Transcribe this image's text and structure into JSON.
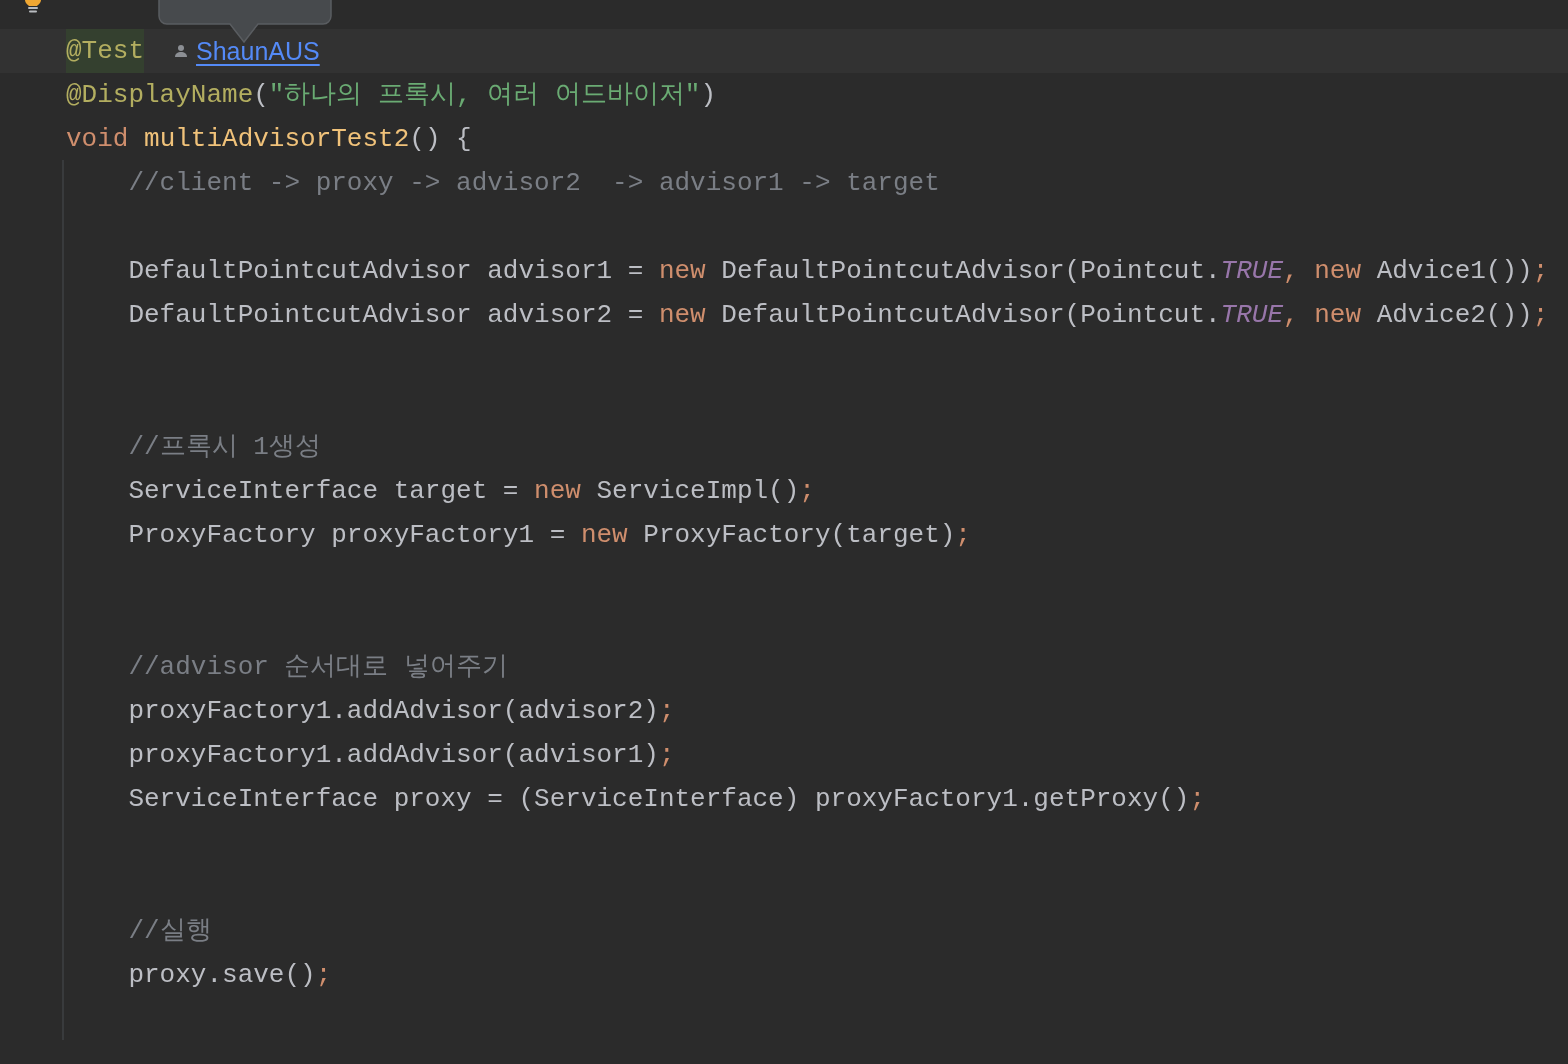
{
  "editor": {
    "lines": [
      {
        "kind": "current_code",
        "tokens": [
          {
            "kind": "annotation_match",
            "text": "@Test"
          }
        ],
        "author": "ShaunAUS"
      },
      {
        "kind": "code",
        "tokens": [
          {
            "kind": "annotation",
            "text": "@DisplayName"
          },
          {
            "kind": "plain",
            "text": "("
          },
          {
            "kind": "string",
            "text": "\"하나의 프록시, 여러 어드바이저\""
          },
          {
            "kind": "plain",
            "text": ")"
          }
        ]
      },
      {
        "kind": "code",
        "tokens": [
          {
            "kind": "keyword",
            "text": "void"
          },
          {
            "kind": "method",
            "text": " multiAdvisorTest2"
          },
          {
            "kind": "plain",
            "text": "() {"
          }
        ]
      },
      {
        "kind": "code",
        "tokens": [
          {
            "kind": "comment",
            "text": "    //client -> proxy -> advisor2  -> advisor1 -> target"
          }
        ]
      },
      {
        "kind": "blank"
      },
      {
        "kind": "code",
        "tokens": [
          {
            "kind": "plain",
            "text": "    DefaultPointcutAdvisor advisor1 = "
          },
          {
            "kind": "keyword",
            "text": "new"
          },
          {
            "kind": "plain",
            "text": " DefaultPointcutAdvisor(Pointcut."
          },
          {
            "kind": "constant",
            "text": "TRUE"
          },
          {
            "kind": "keyword",
            "text": ", new"
          },
          {
            "kind": "plain",
            "text": " Advice1())"
          },
          {
            "kind": "keyword",
            "text": ";"
          }
        ]
      },
      {
        "kind": "code",
        "tokens": [
          {
            "kind": "plain",
            "text": "    DefaultPointcutAdvisor advisor2 = "
          },
          {
            "kind": "keyword",
            "text": "new"
          },
          {
            "kind": "plain",
            "text": " DefaultPointcutAdvisor(Pointcut."
          },
          {
            "kind": "constant",
            "text": "TRUE"
          },
          {
            "kind": "keyword",
            "text": ", new"
          },
          {
            "kind": "plain",
            "text": " Advice2())"
          },
          {
            "kind": "keyword",
            "text": ";"
          }
        ]
      },
      {
        "kind": "blank"
      },
      {
        "kind": "blank"
      },
      {
        "kind": "code",
        "tokens": [
          {
            "kind": "comment",
            "text": "    //프록시 1생성"
          }
        ]
      },
      {
        "kind": "code",
        "tokens": [
          {
            "kind": "plain",
            "text": "    ServiceInterface target = "
          },
          {
            "kind": "keyword",
            "text": "new"
          },
          {
            "kind": "plain",
            "text": " ServiceImpl()"
          },
          {
            "kind": "keyword",
            "text": ";"
          }
        ]
      },
      {
        "kind": "code",
        "tokens": [
          {
            "kind": "plain",
            "text": "    ProxyFactory proxyFactory1 = "
          },
          {
            "kind": "keyword",
            "text": "new"
          },
          {
            "kind": "plain",
            "text": " ProxyFactory(target)"
          },
          {
            "kind": "keyword",
            "text": ";"
          }
        ]
      },
      {
        "kind": "blank"
      },
      {
        "kind": "blank"
      },
      {
        "kind": "code",
        "tokens": [
          {
            "kind": "comment",
            "text": "    //advisor 순서대로 넣어주기"
          }
        ]
      },
      {
        "kind": "code",
        "tokens": [
          {
            "kind": "plain",
            "text": "    proxyFactory1.addAdvisor(advisor2)"
          },
          {
            "kind": "keyword",
            "text": ";"
          }
        ]
      },
      {
        "kind": "code",
        "tokens": [
          {
            "kind": "plain",
            "text": "    proxyFactory1.addAdvisor(advisor1)"
          },
          {
            "kind": "keyword",
            "text": ";"
          }
        ]
      },
      {
        "kind": "code",
        "tokens": [
          {
            "kind": "plain",
            "text": "    ServiceInterface proxy = (ServiceInterface) proxyFactory1.getProxy()"
          },
          {
            "kind": "keyword",
            "text": ";"
          }
        ]
      },
      {
        "kind": "blank"
      },
      {
        "kind": "blank"
      },
      {
        "kind": "code",
        "tokens": [
          {
            "kind": "comment",
            "text": "    //실행"
          }
        ]
      },
      {
        "kind": "code",
        "tokens": [
          {
            "kind": "plain",
            "text": "    proxy.save()"
          },
          {
            "kind": "keyword",
            "text": ";"
          }
        ]
      },
      {
        "kind": "blank"
      }
    ]
  }
}
